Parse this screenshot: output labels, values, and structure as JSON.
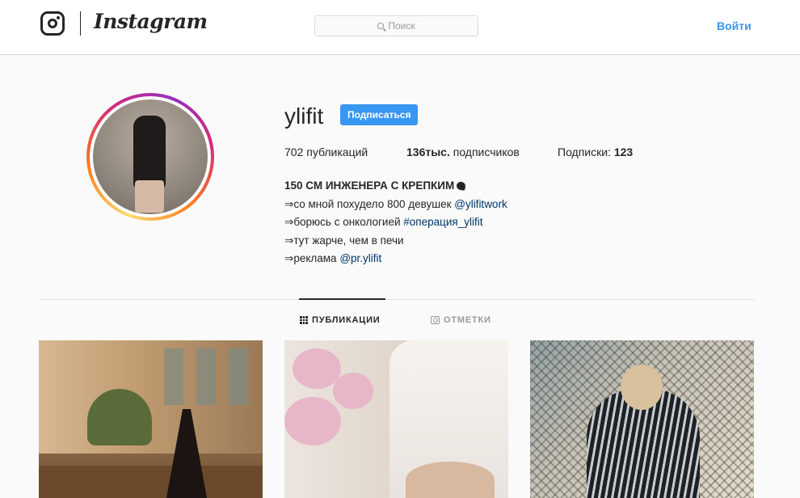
{
  "header": {
    "wordmark": "Instagram",
    "search_placeholder": "Поиск",
    "login_label": "Войти",
    "accent_color": "#3897f0"
  },
  "profile": {
    "username": "ylifit",
    "follow_label": "Подписаться",
    "stats": {
      "posts_count": "702",
      "posts_label": "публикаций",
      "followers_count": "136тыс.",
      "followers_label": "подписчиков",
      "following_label": "Подписки:",
      "following_count": "123"
    },
    "bio": {
      "title": "150 СМ ИНЖЕНЕРА С КРЕПКИМ",
      "lines": [
        {
          "prefix": "⇒",
          "text": "со мной похудело 800 девушек ",
          "link": "@ylifitwork"
        },
        {
          "prefix": "⇒",
          "text": "борюсь с онкологией ",
          "link": "#операция_ylifit"
        },
        {
          "prefix": "⇒",
          "text": "тут жарче, чем в печи",
          "link": ""
        },
        {
          "prefix": "⇒",
          "text": "реклама ",
          "link": "@pr.ylifit"
        }
      ]
    }
  },
  "tabs": [
    {
      "label": "ПУБЛИКАЦИИ",
      "icon": "grid-icon",
      "active": true
    },
    {
      "label": "ОТМЕТКИ",
      "icon": "tagged-icon",
      "active": false
    }
  ],
  "posts": [
    {
      "name": "post-1"
    },
    {
      "name": "post-2"
    },
    {
      "name": "post-3"
    }
  ]
}
